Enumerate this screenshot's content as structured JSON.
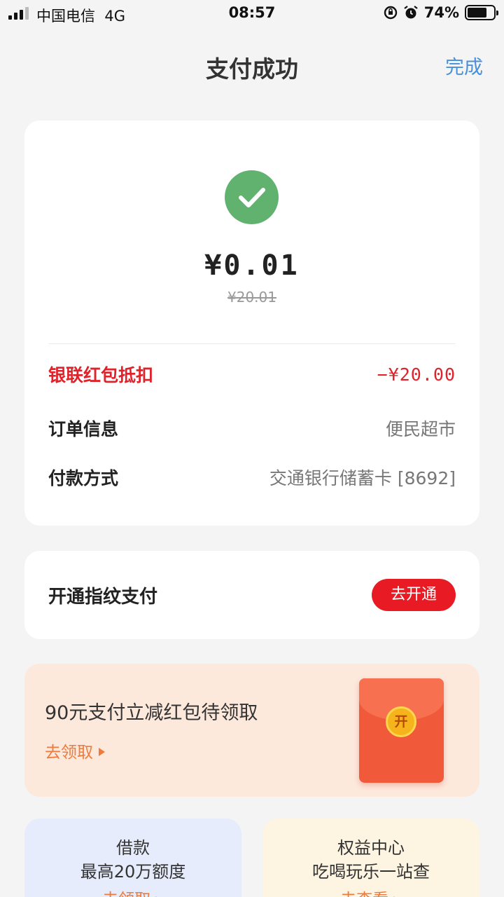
{
  "status_bar": {
    "carrier": "中国电信",
    "network": "4G",
    "time": "08:57",
    "battery": "74%",
    "battery_level": 0.74
  },
  "header": {
    "title": "支付成功",
    "done_label": "完成"
  },
  "payment": {
    "amount": "¥0.01",
    "original_amount": "¥20.01",
    "rows": [
      {
        "label": "银联红包抵扣",
        "value": "−¥20.00"
      },
      {
        "label": "订单信息",
        "value": "便民超市"
      },
      {
        "label": "付款方式",
        "value": "交通银行储蓄卡 [8692]"
      }
    ]
  },
  "fingerprint": {
    "label": "开通指纹支付",
    "button": "去开通"
  },
  "promo": {
    "title": "90元支付立减红包待领取",
    "link": "去领取",
    "envelope_char": "开"
  },
  "tiles": [
    {
      "title": "借款",
      "subtitle": "最高20万额度",
      "link": "去领取"
    },
    {
      "title": "权益中心",
      "subtitle": "吃喝玩乐一站查",
      "link": "去查看"
    }
  ],
  "colors": {
    "accent_red": "#e81b24",
    "success_green": "#62b26f",
    "link_blue": "#4a90d9",
    "promo_orange": "#ef7a3c"
  }
}
